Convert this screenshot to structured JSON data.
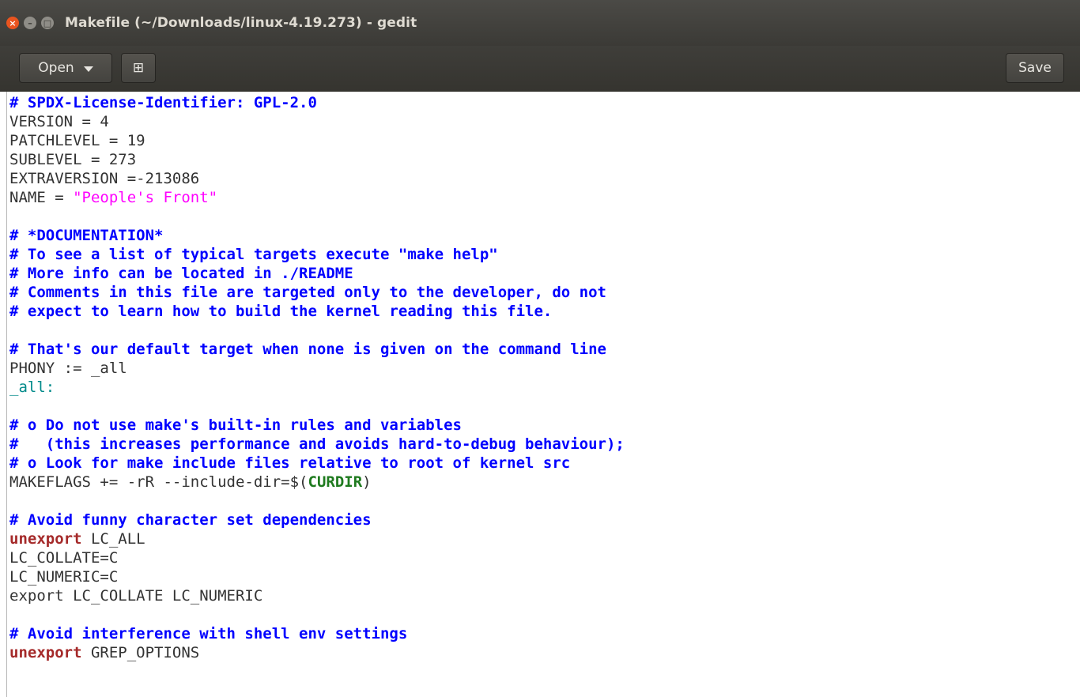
{
  "window": {
    "title": "Makefile (~/Downloads/linux-4.19.273) - gedit",
    "close_glyph": "×",
    "minimize_glyph": "–",
    "maximize_glyph": "□"
  },
  "toolbar": {
    "open_label": "Open",
    "new_tab_glyph": "⊞",
    "save_label": "Save"
  },
  "editor": {
    "lines": [
      [
        {
          "t": "# SPDX-License-Identifier: GPL-2.0",
          "c": "c"
        }
      ],
      [
        {
          "t": "VERSION = 4",
          "c": ""
        }
      ],
      [
        {
          "t": "PATCHLEVEL = 19",
          "c": ""
        }
      ],
      [
        {
          "t": "SUBLEVEL = 273",
          "c": ""
        }
      ],
      [
        {
          "t": "EXTRAVERSION =-213086",
          "c": ""
        }
      ],
      [
        {
          "t": "NAME = ",
          "c": ""
        },
        {
          "t": "\"People's Front\"",
          "c": "s"
        }
      ],
      [],
      [
        {
          "t": "# *DOCUMENTATION*",
          "c": "c"
        }
      ],
      [
        {
          "t": "# To see a list of typical targets execute \"make help\"",
          "c": "c"
        }
      ],
      [
        {
          "t": "# More info can be located in ./README",
          "c": "c"
        }
      ],
      [
        {
          "t": "# Comments in this file are targeted only to the developer, do not",
          "c": "c"
        }
      ],
      [
        {
          "t": "# expect to learn how to build the kernel reading this file.",
          "c": "c"
        }
      ],
      [],
      [
        {
          "t": "# That's our default target when none is given on the command line",
          "c": "c"
        }
      ],
      [
        {
          "t": "PHONY := _all",
          "c": ""
        }
      ],
      [
        {
          "t": "_all:",
          "c": "t"
        }
      ],
      [],
      [
        {
          "t": "# o Do not use make's built-in rules and variables",
          "c": "c"
        }
      ],
      [
        {
          "t": "#   (this increases performance and avoids hard-to-debug behaviour);",
          "c": "c"
        }
      ],
      [
        {
          "t": "# o Look for make include files relative to root of kernel src",
          "c": "c"
        }
      ],
      [
        {
          "t": "MAKEFLAGS += -rR --include-dir=$(",
          "c": ""
        },
        {
          "t": "CURDIR",
          "c": "v"
        },
        {
          "t": ")",
          "c": ""
        }
      ],
      [],
      [
        {
          "t": "# Avoid funny character set dependencies",
          "c": "c"
        }
      ],
      [
        {
          "t": "unexport",
          "c": "k"
        },
        {
          "t": " LC_ALL",
          "c": ""
        }
      ],
      [
        {
          "t": "LC_COLLATE=C",
          "c": ""
        }
      ],
      [
        {
          "t": "LC_NUMERIC=C",
          "c": ""
        }
      ],
      [
        {
          "t": "export LC_COLLATE LC_NUMERIC",
          "c": ""
        }
      ],
      [],
      [
        {
          "t": "# Avoid interference with shell env settings",
          "c": "c"
        }
      ],
      [
        {
          "t": "unexport",
          "c": "k"
        },
        {
          "t": " GREP_OPTIONS",
          "c": ""
        }
      ]
    ]
  }
}
